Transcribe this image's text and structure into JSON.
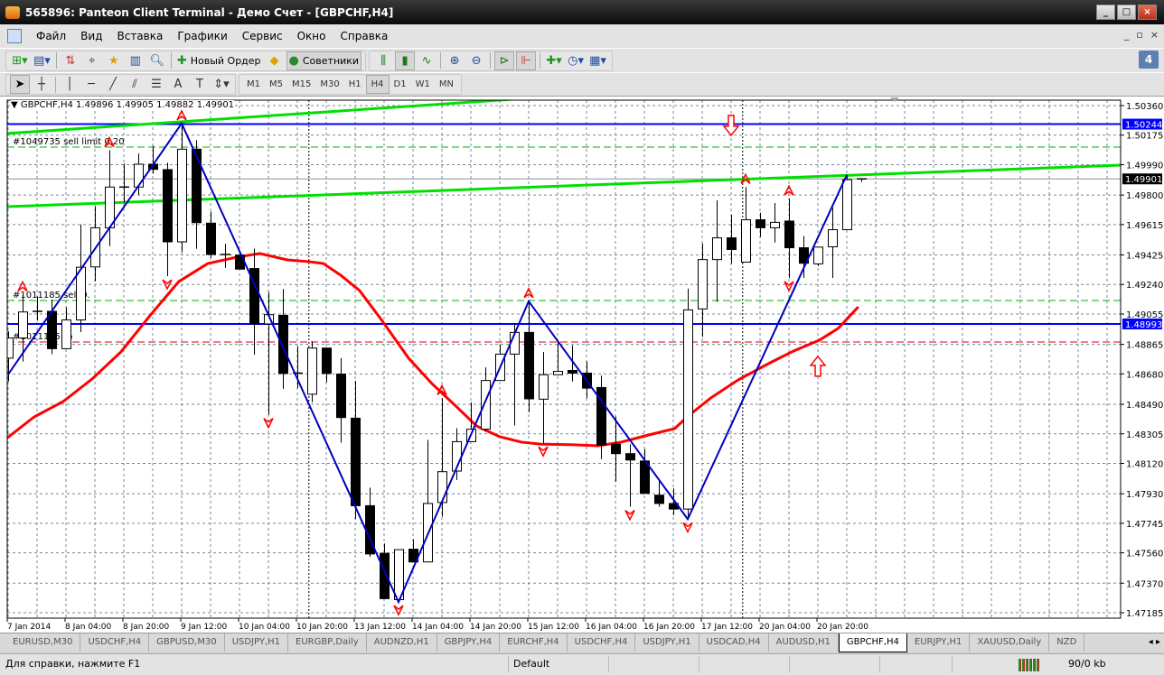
{
  "window": {
    "title": "565896: Panteon Client Terminal - Демо Счет - [GBPCHF,H4]",
    "minimize": "_",
    "maximize": "□",
    "close": "×"
  },
  "menu": {
    "items": [
      "Файл",
      "Вид",
      "Вставка",
      "Графики",
      "Сервис",
      "Окно",
      "Справка"
    ],
    "mdi": [
      "_",
      "▫",
      "×"
    ]
  },
  "toolbar": {
    "new_order": "Новый Ордер",
    "experts": "Советники",
    "notifications": "4"
  },
  "timeframes": {
    "items": [
      "M1",
      "M5",
      "M15",
      "M30",
      "H1",
      "H4",
      "D1",
      "W1",
      "MN"
    ],
    "active": "H4"
  },
  "chart_header": {
    "symbol": "GBPCHF,H4",
    "open": "1.49896",
    "high": "1.49905",
    "low": "1.49882",
    "close": "1.49901"
  },
  "chart_data": {
    "type": "candlestick",
    "symbol": "GBPCHF",
    "timeframe": "H4",
    "ylim": [
      1.47185,
      1.5036
    ],
    "y_ticks": [
      "1.50360",
      "1.50175",
      "1.49990",
      "1.49800",
      "1.49615",
      "1.49425",
      "1.49240",
      "1.49055",
      "1.48865",
      "1.48680",
      "1.48490",
      "1.48305",
      "1.48120",
      "1.47930",
      "1.47745",
      "1.47560",
      "1.47370",
      "1.47185"
    ],
    "x_ticks": [
      {
        "i": 0,
        "label": "7 Jan 2014"
      },
      {
        "i": 4,
        "label": "8 Jan 04:00"
      },
      {
        "i": 8,
        "label": "8 Jan 20:00"
      },
      {
        "i": 12,
        "label": "9 Jan 12:00"
      },
      {
        "i": 16,
        "label": "10 Jan 04:00"
      },
      {
        "i": 20,
        "label": "10 Jan 20:00"
      },
      {
        "i": 24,
        "label": "13 Jan 12:00"
      },
      {
        "i": 28,
        "label": "14 Jan 04:00"
      },
      {
        "i": 32,
        "label": "14 Jan 20:00"
      },
      {
        "i": 36,
        "label": "15 Jan 12:00"
      },
      {
        "i": 40,
        "label": "16 Jan 04:00"
      },
      {
        "i": 44,
        "label": "16 Jan 20:00"
      },
      {
        "i": 48,
        "label": "17 Jan 12:00"
      },
      {
        "i": 52,
        "label": "20 Jan 04:00"
      },
      {
        "i": 56,
        "label": "20 Jan 20:00"
      }
    ],
    "ohlc": [
      [
        1.48779,
        1.48947,
        1.48633,
        1.48905
      ],
      [
        1.48905,
        1.49177,
        1.48758,
        1.49068
      ],
      [
        1.49072,
        1.49166,
        1.49014,
        1.4907
      ],
      [
        1.49072,
        1.49145,
        1.48804,
        1.48838
      ],
      [
        1.48838,
        1.49097,
        1.48836,
        1.49018
      ],
      [
        1.49018,
        1.49616,
        1.48942,
        1.49348
      ],
      [
        1.4935,
        1.49731,
        1.4926,
        1.49595
      ],
      [
        1.49595,
        1.5008,
        1.4948,
        1.4985
      ],
      [
        1.4985,
        1.49997,
        1.49752,
        1.49848
      ],
      [
        1.4985,
        1.5006,
        1.498,
        1.49993
      ],
      [
        1.49993,
        1.50108,
        1.49934,
        1.49961
      ],
      [
        1.49959,
        1.50003,
        1.49292,
        1.49507
      ],
      [
        1.49507,
        1.50248,
        1.49444,
        1.50087
      ],
      [
        1.50087,
        1.50143,
        1.49463,
        1.49627
      ],
      [
        1.49624,
        1.49696,
        1.49407,
        1.49428
      ],
      [
        1.49428,
        1.49495,
        1.49344,
        1.49426
      ],
      [
        1.49424,
        1.49426,
        1.49336,
        1.49336
      ],
      [
        1.4934,
        1.49465,
        1.488,
        1.48993
      ],
      [
        1.48993,
        1.49193,
        1.48424,
        1.49051
      ],
      [
        1.49047,
        1.49212,
        1.48587,
        1.48683
      ],
      [
        1.48683,
        1.48852,
        1.48591,
        1.48685
      ],
      [
        1.48553,
        1.48884,
        1.48503,
        1.48842
      ],
      [
        1.48842,
        1.48845,
        1.48629,
        1.48683
      ],
      [
        1.48679,
        1.48779,
        1.4825,
        1.48407
      ],
      [
        1.48403,
        1.48637,
        1.47771,
        1.47855
      ],
      [
        1.47855,
        1.47968,
        1.47535,
        1.47553
      ],
      [
        1.47557,
        1.47618,
        1.47273,
        1.47273
      ],
      [
        1.47267,
        1.4758,
        1.47252,
        1.4758
      ],
      [
        1.47583,
        1.47645,
        1.47503,
        1.47503
      ],
      [
        1.47503,
        1.48267,
        1.47499,
        1.47869
      ],
      [
        1.47875,
        1.48528,
        1.47786,
        1.48068
      ],
      [
        1.48072,
        1.4834,
        1.48016,
        1.48256
      ],
      [
        1.48256,
        1.48503,
        1.48256,
        1.48334
      ],
      [
        1.48334,
        1.48721,
        1.48319,
        1.48639
      ],
      [
        1.48639,
        1.48863,
        1.48639,
        1.48804
      ],
      [
        1.48804,
        1.48999,
        1.48357,
        1.4894
      ],
      [
        1.4894,
        1.49135,
        1.4844,
        1.48524
      ],
      [
        1.48522,
        1.48817,
        1.48246,
        1.48675
      ],
      [
        1.48675,
        1.48884,
        1.48675,
        1.48696
      ],
      [
        1.48702,
        1.48859,
        1.48633,
        1.48685
      ],
      [
        1.48685,
        1.48758,
        1.48528,
        1.48591
      ],
      [
        1.48595,
        1.4867,
        1.48147,
        1.48235
      ],
      [
        1.4824,
        1.48413,
        1.48005,
        1.48181
      ],
      [
        1.48181,
        1.4824,
        1.47848,
        1.48141
      ],
      [
        1.48135,
        1.4821,
        1.47932,
        1.47932
      ],
      [
        1.47921,
        1.48016,
        1.47848,
        1.47869
      ],
      [
        1.47869,
        1.47963,
        1.47796,
        1.47834
      ],
      [
        1.47834,
        1.49214,
        1.47771,
        1.49081
      ],
      [
        1.49087,
        1.49497,
        1.48913,
        1.49396
      ],
      [
        1.49396,
        1.49767,
        1.49131,
        1.49532
      ],
      [
        1.49532,
        1.49675,
        1.49371,
        1.49459
      ],
      [
        1.4938,
        1.4985,
        1.4938,
        1.49645
      ],
      [
        1.49645,
        1.49689,
        1.49537,
        1.49595
      ],
      [
        1.49595,
        1.4975,
        1.49503,
        1.49629
      ],
      [
        1.49637,
        1.49777,
        1.49281,
        1.4947
      ],
      [
        1.4947,
        1.49543,
        1.49281,
        1.49373
      ],
      [
        1.49369,
        1.49474,
        1.49355,
        1.49474
      ],
      [
        1.49476,
        1.49721,
        1.49281,
        1.49583
      ],
      [
        1.49583,
        1.49926,
        1.49583,
        1.49896
      ],
      [
        1.49896,
        1.49905,
        1.49882,
        1.49901
      ]
    ],
    "moving_average": [
      [
        -0.2,
        1.4827
      ],
      [
        1.8,
        1.48411
      ],
      [
        3.8,
        1.48507
      ],
      [
        5.8,
        1.48648
      ],
      [
        7.8,
        1.48818
      ],
      [
        9.8,
        1.49044
      ],
      [
        11.8,
        1.49258
      ],
      [
        13.8,
        1.49371
      ],
      [
        15.8,
        1.49411
      ],
      [
        17.4,
        1.49434
      ],
      [
        19.3,
        1.49394
      ],
      [
        20.8,
        1.49383
      ],
      [
        21.8,
        1.49371
      ],
      [
        23.0,
        1.49298
      ],
      [
        24.3,
        1.49202
      ],
      [
        25.8,
        1.49021
      ],
      [
        27.7,
        1.48778
      ],
      [
        29.3,
        1.4862
      ],
      [
        31.1,
        1.48467
      ],
      [
        32.4,
        1.48354
      ],
      [
        34.0,
        1.48287
      ],
      [
        35.5,
        1.48253
      ],
      [
        36.8,
        1.48241
      ],
      [
        39.3,
        1.48236
      ],
      [
        40.8,
        1.4823
      ],
      [
        42.4,
        1.48253
      ],
      [
        44.3,
        1.48298
      ],
      [
        46.1,
        1.48338
      ],
      [
        47.1,
        1.48422
      ],
      [
        48.6,
        1.4853
      ],
      [
        50.5,
        1.48643
      ],
      [
        52.7,
        1.4875
      ],
      [
        54.3,
        1.48823
      ],
      [
        56.1,
        1.48891
      ],
      [
        57.4,
        1.48965
      ],
      [
        58.8,
        1.491
      ]
    ],
    "zigzag": [
      [
        0,
        1.48677
      ],
      [
        12,
        1.50248
      ],
      [
        27,
        1.47252
      ],
      [
        36,
        1.49135
      ],
      [
        47,
        1.47771
      ],
      [
        58,
        1.49926
      ]
    ],
    "trendlines": [
      {
        "from": [
          -0.1,
          1.50185
        ],
        "to": [
          35,
          1.504
        ],
        "color": "#00e000"
      },
      {
        "from": [
          -0.1,
          1.49727
        ],
        "to": [
          77,
          1.49987
        ],
        "color": "#00e000"
      }
    ],
    "hlines": [
      {
        "price": 1.50244,
        "label": "1.50244",
        "color": "#0000ff"
      },
      {
        "price": 1.48993,
        "label": "1.48993",
        "color": "#0000ff"
      }
    ],
    "bid": {
      "price": 1.49901,
      "label": "1.49901"
    },
    "orders": [
      {
        "price": 1.501,
        "label": "#1049735 sell limit 0.20",
        "color": "#00b000"
      },
      {
        "price": 1.4914,
        "label": "#1011185 sell 0.",
        "color": "#00b000"
      },
      {
        "price": 1.4888,
        "label": "#1011185 tp",
        "color": "#e00000"
      }
    ],
    "fractals_up": [
      1,
      7,
      12,
      30,
      36,
      51,
      54
    ],
    "fractals_down": [
      11,
      18,
      27,
      37,
      43,
      47,
      54
    ],
    "signal_arrows": [
      {
        "i": 50,
        "price": 1.50174,
        "dir": "down"
      },
      {
        "i": 56,
        "price": 1.4879,
        "dir": "up"
      }
    ],
    "separators": [
      20.8,
      50.8
    ]
  },
  "tabs": {
    "items": [
      "EURUSD,M30",
      "USDCHF,H4",
      "GBPUSD,M30",
      "USDJPY,H1",
      "EURGBP,Daily",
      "AUDNZD,H1",
      "GBPJPY,H4",
      "EURCHF,H4",
      "USDCHF,H4",
      "USDJPY,H1",
      "USDCAD,H4",
      "AUDUSD,H1",
      "GBPCHF,H4",
      "EURJPY,H1",
      "XAUUSD,Daily",
      "NZD"
    ],
    "active": "GBPCHF,H4"
  },
  "status": {
    "help": "Для справки, нажмите F1",
    "profile": "Default",
    "traffic": "90/0 kb"
  },
  "colors": {
    "bull": "#ffffff",
    "bear": "#000000",
    "ma": "#ff0000",
    "zigzag": "#0000c0",
    "grid": "#778899"
  }
}
